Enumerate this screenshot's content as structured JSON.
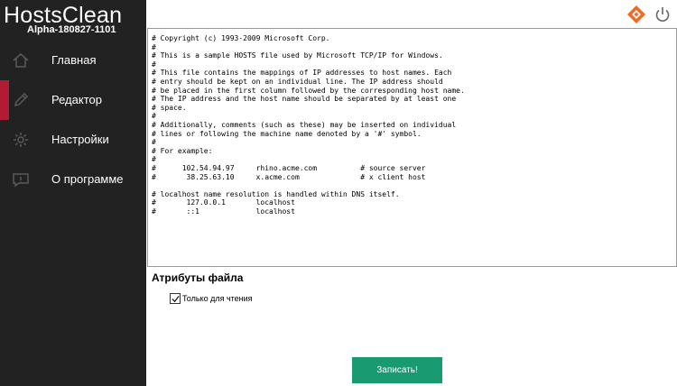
{
  "app": {
    "title": "HostsClean",
    "version": "Alpha-180827-1101"
  },
  "sidebar": {
    "items": [
      {
        "label": "Главная",
        "icon": "home-icon",
        "active": false
      },
      {
        "label": "Редактор",
        "icon": "pencil-icon",
        "active": true
      },
      {
        "label": "Настройки",
        "icon": "gear-icon",
        "active": false
      },
      {
        "label": "О программе",
        "icon": "info-icon",
        "active": false
      }
    ]
  },
  "topbar": {
    "logo_icon": "diamond-logo-icon",
    "power_icon": "power-icon"
  },
  "editor": {
    "content": "# Copyright (c) 1993-2009 Microsoft Corp.\n#\n# This is a sample HOSTS file used by Microsoft TCP/IP for Windows.\n#\n# This file contains the mappings of IP addresses to host names. Each\n# entry should be kept on an individual line. The IP address should\n# be placed in the first column followed by the corresponding host name.\n# The IP address and the host name should be separated by at least one\n# space.\n#\n# Additionally, comments (such as these) may be inserted on individual\n# lines or following the machine name denoted by a '#' symbol.\n#\n# For example:\n#\n#      102.54.94.97     rhino.acme.com          # source server\n#       38.25.63.10     x.acme.com              # x client host\n\n# localhost name resolution is handled within DNS itself.\n#\t127.0.0.1       localhost\n#\t::1             localhost"
  },
  "attributes": {
    "title": "Атрибуты файла",
    "readonly_label": "Только для чтения",
    "readonly_checked": true
  },
  "actions": {
    "write_label": "Записать!"
  },
  "colors": {
    "sidebar_bg": "#222222",
    "active_marker": "#b31b35",
    "button_bg": "#1a9a71",
    "logo_orange": "#f26a21",
    "icon_gray": "#5a5a5a"
  }
}
